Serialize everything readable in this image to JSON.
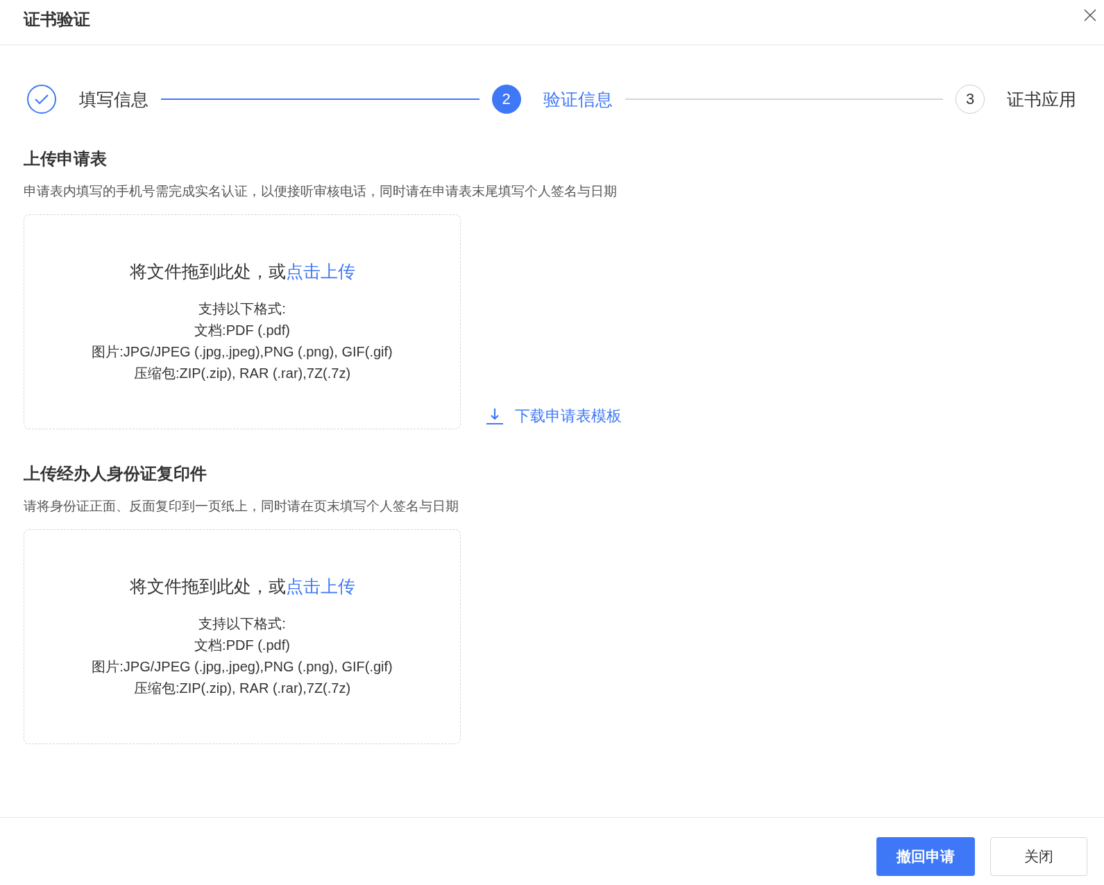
{
  "dialog": {
    "title": "证书验证"
  },
  "steps": [
    {
      "label": "填写信息",
      "completed": true,
      "selected": false
    },
    {
      "number": "2",
      "label": "验证信息",
      "completed": false,
      "selected": true
    },
    {
      "number": "3",
      "label": "证书应用",
      "completed": false,
      "selected": false
    }
  ],
  "sections": [
    {
      "title": "上传申请表",
      "description": "申请表内填写的手机号需完成实名认证，以便接听审核电话，同时请在申请表末尾填写个人签名与日期",
      "upload": {
        "prompt": "将文件拖到此处，或",
        "link": "点击上传",
        "formats": [
          "支持以下格式:",
          "文档:PDF (.pdf)",
          "图片:JPG/JPEG (.jpg,.jpeg),PNG (.png), GIF(.gif)",
          "压缩包:ZIP(.zip), RAR (.rar),7Z(.7z)"
        ]
      },
      "download_link": "下载申请表模板"
    },
    {
      "title": "上传经办人身份证复印件",
      "description": "请将身份证正面、反面复印到一页纸上，同时请在页末填写个人签名与日期",
      "upload": {
        "prompt": "将文件拖到此处，或",
        "link": "点击上传",
        "formats": [
          "支持以下格式:",
          "文档:PDF (.pdf)",
          "图片:JPG/JPEG (.jpg,.jpeg),PNG (.png), GIF(.gif)",
          "压缩包:ZIP(.zip), RAR (.rar),7Z(.7z)"
        ]
      }
    }
  ],
  "buttons": [
    {
      "label": "撤回申请",
      "kind": "primary"
    },
    {
      "label": "关闭",
      "kind": "default"
    }
  ]
}
